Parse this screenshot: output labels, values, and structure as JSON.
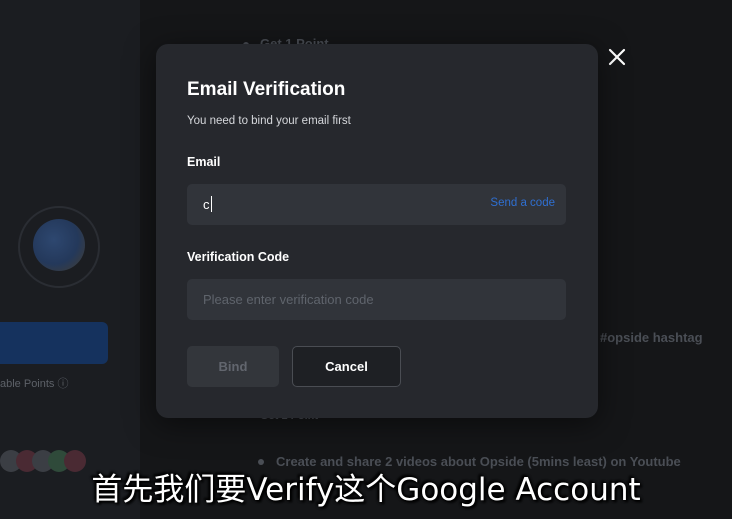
{
  "background": {
    "heading": "Get 1 Point",
    "hashtag": "#opside hashtag",
    "points_label": "able Points",
    "section_heading": "Get 1 Point",
    "task": "Create and share 2 videos about Opside (5mins least) on Youtube"
  },
  "modal": {
    "title": "Email Verification",
    "subtitle": "You need to bind your email first",
    "email": {
      "label": "Email",
      "value": "c",
      "send_code_label": "Send a code"
    },
    "verification_code": {
      "label": "Verification Code",
      "placeholder": "Please enter verification code"
    },
    "bind_label": "Bind",
    "cancel_label": "Cancel"
  },
  "video_subtitle": "首先我们要Verify这个Google Account",
  "colors": {
    "modal_bg": "#26282d",
    "field_bg": "#31343a",
    "link": "#2f6fd1",
    "text": "#ffffff"
  },
  "icons": {
    "close": "close-icon",
    "points_info": "info-icon"
  }
}
